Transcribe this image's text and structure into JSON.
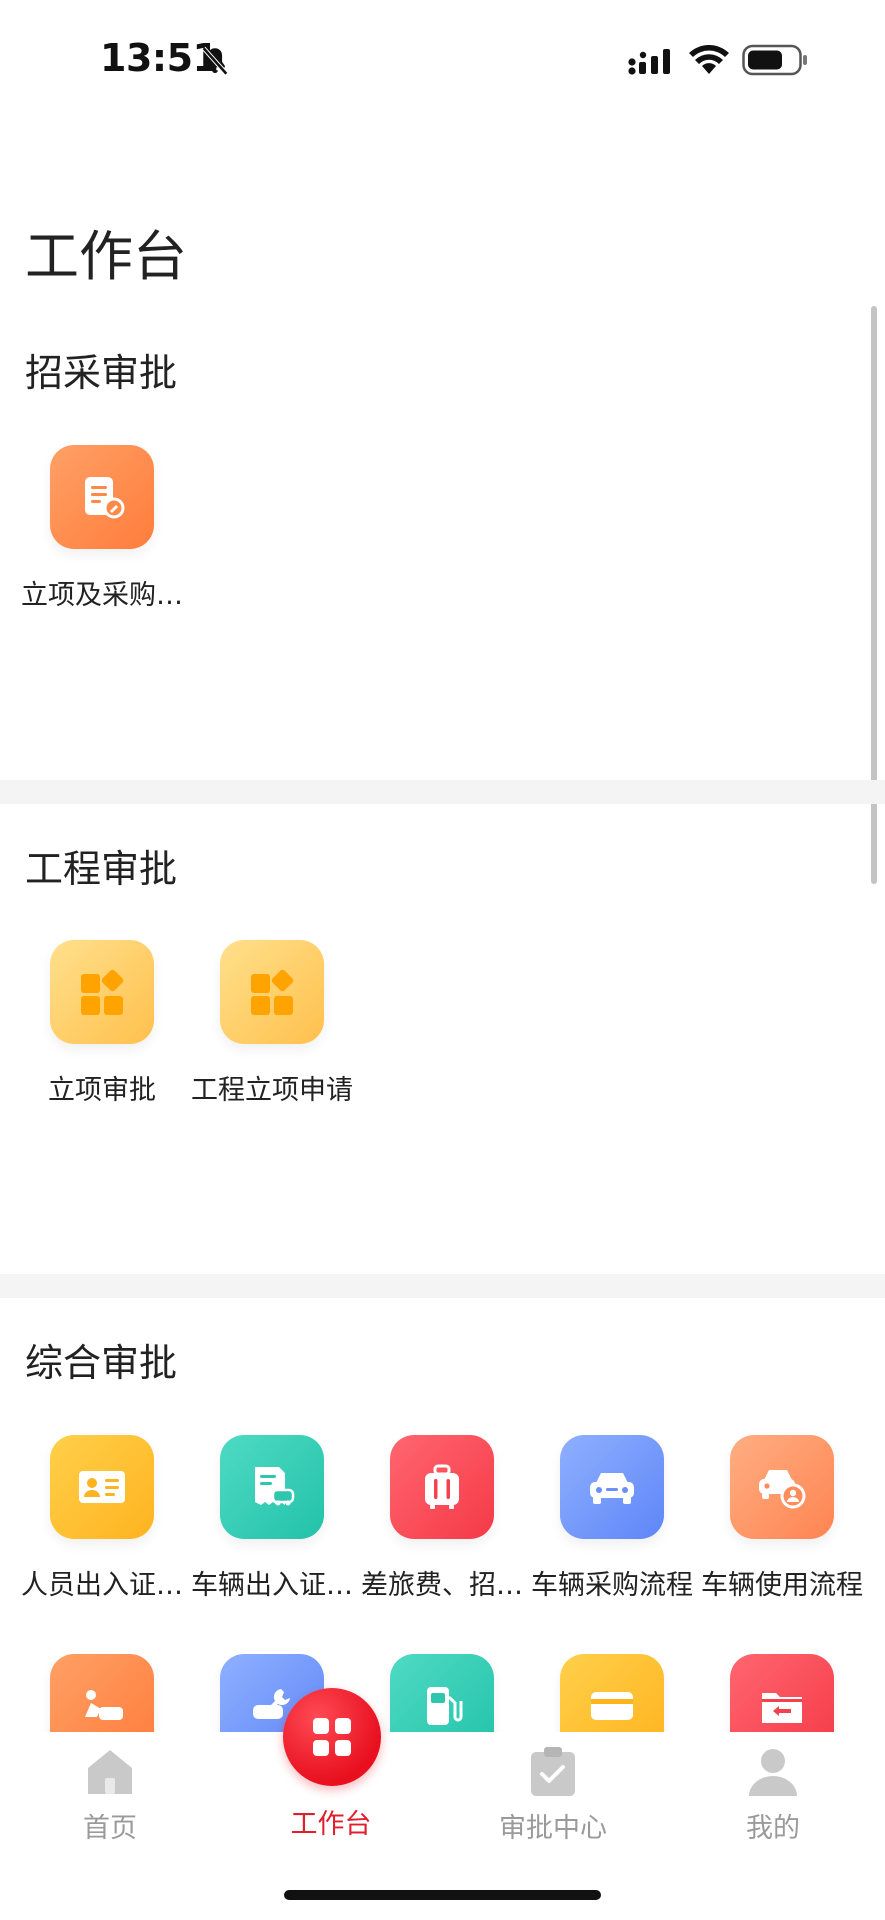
{
  "status_bar": {
    "time": "13:51"
  },
  "page": {
    "title": "工作台"
  },
  "sections": [
    {
      "title": "招采审批",
      "items": [
        {
          "label": "立项及采购…",
          "icon": "document-edit-icon"
        }
      ]
    },
    {
      "title": "工程审批",
      "items": [
        {
          "label": "立项审批",
          "icon": "apps-grid-icon"
        },
        {
          "label": "工程立项申请",
          "icon": "apps-grid-icon"
        }
      ]
    },
    {
      "title": "综合审批",
      "items": [
        {
          "label": "人员出入证…",
          "icon": "id-card-icon"
        },
        {
          "label": "车辆出入证…",
          "icon": "vehicle-pass-icon"
        },
        {
          "label": "差旅费、招…",
          "icon": "luggage-icon"
        },
        {
          "label": "车辆采购流程",
          "icon": "car-icon"
        },
        {
          "label": "车辆使用流程",
          "icon": "car-user-icon"
        },
        {
          "label": "",
          "icon": "car-repair-icon"
        },
        {
          "label": "",
          "icon": "car-maintenance-icon"
        },
        {
          "label": "",
          "icon": "fuel-icon"
        },
        {
          "label": "",
          "icon": "card-icon"
        },
        {
          "label": "",
          "icon": "folder-return-icon"
        }
      ]
    }
  ],
  "tabbar": {
    "tabs": [
      {
        "label": "首页",
        "icon": "home-icon",
        "active": false
      },
      {
        "label": "工作台",
        "icon": "workbench-grid-icon",
        "active": true
      },
      {
        "label": "审批中心",
        "icon": "clipboard-check-icon",
        "active": false
      },
      {
        "label": "我的",
        "icon": "person-icon",
        "active": false
      }
    ]
  },
  "colors": {
    "accent": "#e01f2c",
    "inactive": "#9a9a9a",
    "divider": "#f4f4f4"
  }
}
